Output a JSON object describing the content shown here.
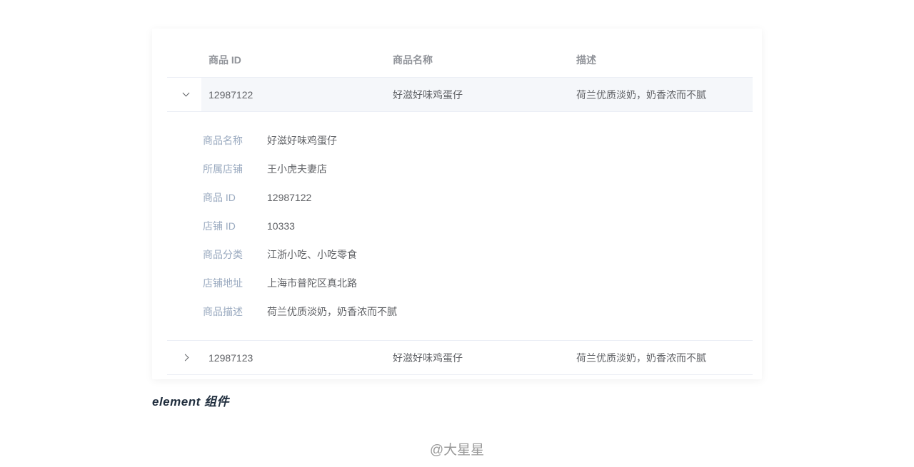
{
  "table": {
    "headers": [
      "商品 ID",
      "商品名称",
      "描述"
    ],
    "rows": [
      {
        "id": "12987122",
        "name": "好滋好味鸡蛋仔",
        "desc": "荷兰优质淡奶，奶香浓而不腻",
        "expanded": true
      },
      {
        "id": "12987123",
        "name": "好滋好味鸡蛋仔",
        "desc": "荷兰优质淡奶，奶香浓而不腻",
        "expanded": false
      }
    ],
    "details": [
      {
        "label": "商品名称",
        "value": "好滋好味鸡蛋仔"
      },
      {
        "label": "所属店铺",
        "value": "王小虎夫妻店"
      },
      {
        "label": "商品 ID",
        "value": "12987122"
      },
      {
        "label": "店铺 ID",
        "value": "10333"
      },
      {
        "label": "商品分类",
        "value": "江浙小吃、小吃零食"
      },
      {
        "label": "店铺地址",
        "value": "上海市普陀区真北路"
      },
      {
        "label": "商品描述",
        "value": "荷兰优质淡奶，奶香浓而不腻"
      }
    ]
  },
  "caption": "element 组件",
  "watermark": "@大星星",
  "icons": {
    "expanded": "chevron-down-icon",
    "collapsed": "chevron-right-icon"
  },
  "colors": {
    "header_text": "#909399",
    "cell_text": "#606266",
    "detail_label": "#99a9bf",
    "border": "#ebeef5",
    "hover_row": "#f5f7fa"
  }
}
